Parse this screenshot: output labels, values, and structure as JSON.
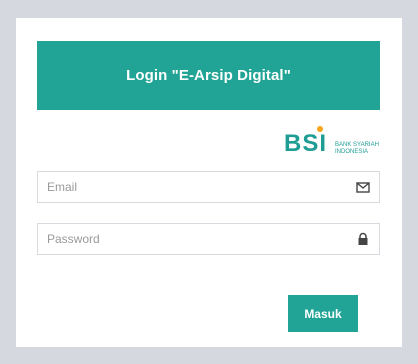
{
  "header": {
    "title": "Login \"E-Arsip Digital\""
  },
  "logo": {
    "brand": "BSI",
    "sub_line1": "BANK SYARIAH",
    "sub_line2": "INDONESIA"
  },
  "form": {
    "email_placeholder": "Email",
    "email_value": "",
    "email_icon": "envelope-icon",
    "password_placeholder": "Password",
    "password_value": "",
    "password_icon": "lock-icon",
    "submit_label": "Masuk"
  },
  "colors": {
    "page_background": "#d5d9df",
    "card_background": "#ffffff",
    "accent": "#21a496",
    "logo_teal": "#1f9c93",
    "logo_dot": "#f4a51c"
  }
}
